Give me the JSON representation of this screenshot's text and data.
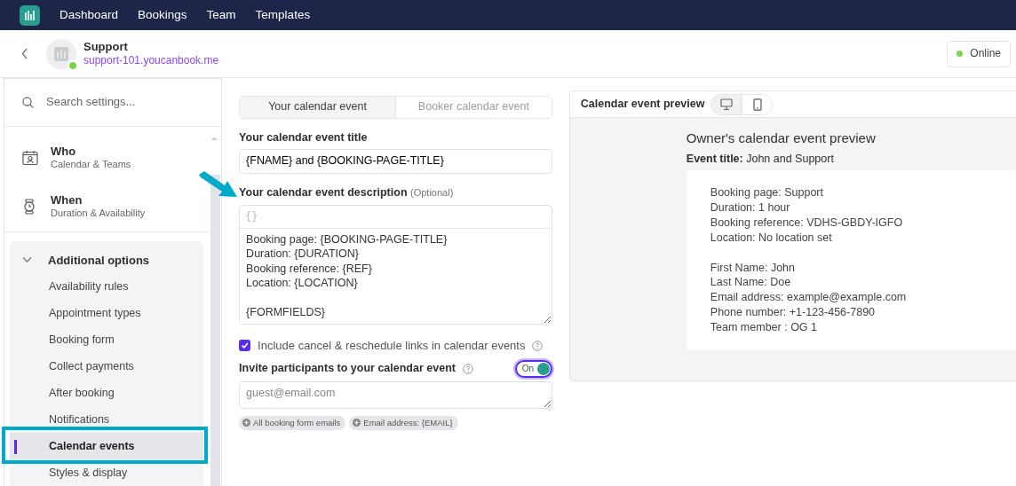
{
  "navbar": {
    "items": [
      {
        "label": "Dashboard"
      },
      {
        "label": "Bookings"
      },
      {
        "label": "Team"
      },
      {
        "label": "Templates"
      }
    ]
  },
  "header": {
    "title": "Support",
    "url": "support-101.youcanbook.me",
    "status": "Online"
  },
  "sidebar": {
    "search": {
      "placeholder": "Search settings..."
    },
    "sections": [
      {
        "kind": "who",
        "title": "Who",
        "subtitle": "Calendar & Teams"
      },
      {
        "kind": "when",
        "title": "When",
        "subtitle": "Duration & Availability"
      }
    ],
    "group": {
      "title": "Additional options",
      "expanded": true,
      "items": [
        {
          "label": "Availability rules",
          "selected": false
        },
        {
          "label": "Appointment types",
          "selected": false
        },
        {
          "label": "Booking form",
          "selected": false
        },
        {
          "label": "Collect payments",
          "selected": false
        },
        {
          "label": "After booking",
          "selected": false
        },
        {
          "label": "Notifications",
          "selected": false
        },
        {
          "label": "Calendar events",
          "selected": true
        },
        {
          "label": "Styles & display",
          "selected": false
        }
      ]
    }
  },
  "form": {
    "tabs": [
      {
        "label": "Your calendar event",
        "selected": true
      },
      {
        "label": "Booker calendar event",
        "selected": false
      }
    ],
    "title_field": {
      "label": "Your calendar event title",
      "value": "{FNAME} and {BOOKING-PAGE-TITLE}"
    },
    "description": {
      "label": "Your calendar event description",
      "hint": "(Optional)",
      "insert_button": "{}",
      "paragraphs": [
        [
          "Booking page: {BOOKING-PAGE-TITLE}",
          "Duration: {DURATION}",
          "Booking reference: {REF}",
          "Location: {LOCATION}"
        ],
        [
          "{FORMFIELDS}"
        ]
      ]
    },
    "links_checkbox": {
      "label": "Include cancel & reschedule links in calendar events",
      "checked": true
    },
    "invite": {
      "label": "Invite participants to your calendar event",
      "on": true,
      "toggle_label": "On",
      "placeholder": "guest@email.com",
      "chips": [
        {
          "label": "All booking form emails"
        },
        {
          "label": "Email address: {EMAIL}"
        }
      ]
    }
  },
  "preview": {
    "title": "Calendar event preview",
    "devices": [
      {
        "kind": "desktop",
        "selected": true
      },
      {
        "kind": "mobile",
        "selected": false
      }
    ],
    "heading": "Owner's calendar event preview",
    "event_title": "**Event title:** John and Support",
    "body": [
      [
        "Booking page: Support",
        "Duration: 1 hour",
        "Booking reference: VDHS-GBDY-IGFO",
        "Location: No location set"
      ],
      [
        "First Name: John",
        "Last Name: Doe",
        "Email address: example@example.com",
        "Phone number: +1-123-456-7890",
        "Team member : OG 1"
      ]
    ]
  }
}
